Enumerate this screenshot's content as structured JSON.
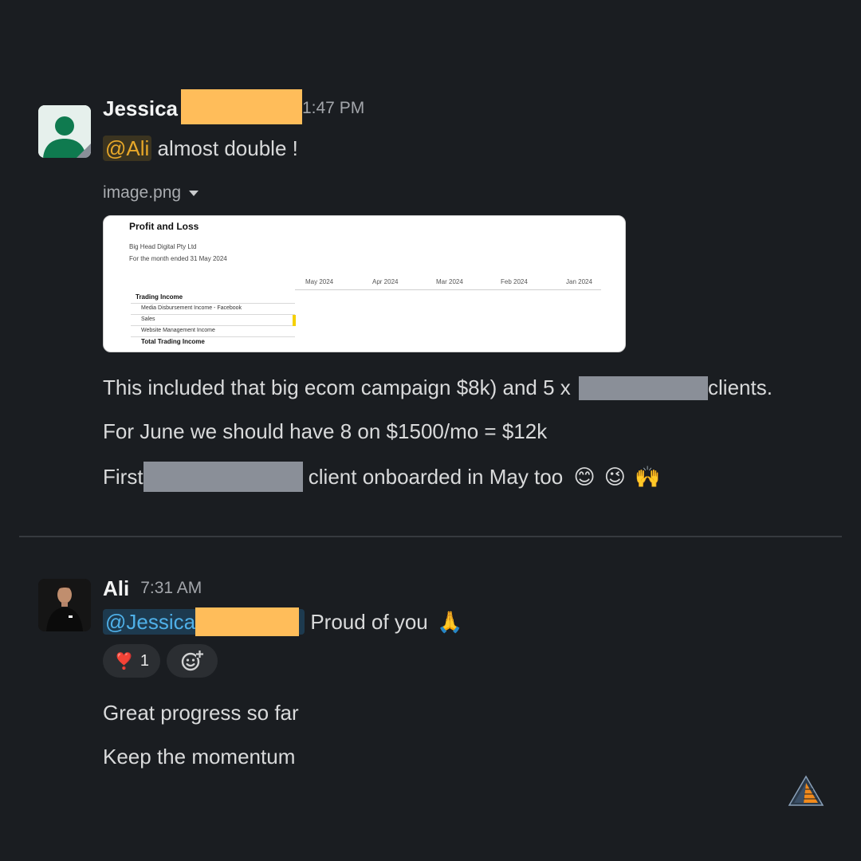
{
  "message_jessica": {
    "sender": "Jessica",
    "timestamp": "1:47 PM",
    "mention": "@Ali",
    "text_after_mention": " almost double !",
    "attachment": {
      "file_name": "image.png",
      "report": {
        "title": "Profit and Loss",
        "company": "Big Head Digital Pty Ltd",
        "period": "For the month ended 31 May 2024",
        "columns": [
          "May 2024",
          "Apr 2024",
          "Mar 2024",
          "Feb 2024",
          "Jan 2024"
        ],
        "section": "Trading Income",
        "rows": [
          "Media Disbursement Income - Facebook",
          "Sales",
          "Website Management Income"
        ],
        "total": "Total Trading Income"
      }
    },
    "line1_before": "This included that big ecom campaign $8k) and 5 x",
    "line1_after": "clients.",
    "line2": "For June we should have 8 on $1500/mo = $12k",
    "line3_before": "First",
    "line3_after": " client onboarded in May too",
    "line3_emojis": [
      "😊",
      "😉",
      "🙌"
    ]
  },
  "message_ali": {
    "sender": "Ali",
    "timestamp": "7:31 AM",
    "mention": "@Jessica",
    "text_after_mention": " Proud of you",
    "emoji": "🙏",
    "reactions": [
      {
        "emoji": "❣️",
        "count": "1"
      }
    ],
    "add_reaction_icon": "add-emoji-icon",
    "line2": "Great progress so far",
    "line3": "Keep the momentum"
  },
  "colors": {
    "background": "#1a1d21",
    "mention_ali_bg": "#3b3420",
    "mention_ali_text": "#e8a829",
    "mention_jessica_bg": "#1d3a4f",
    "mention_jessica_text": "#4fb0e8",
    "redaction_orange": "#ffbd5a",
    "redaction_gray": "#8a8f98"
  }
}
